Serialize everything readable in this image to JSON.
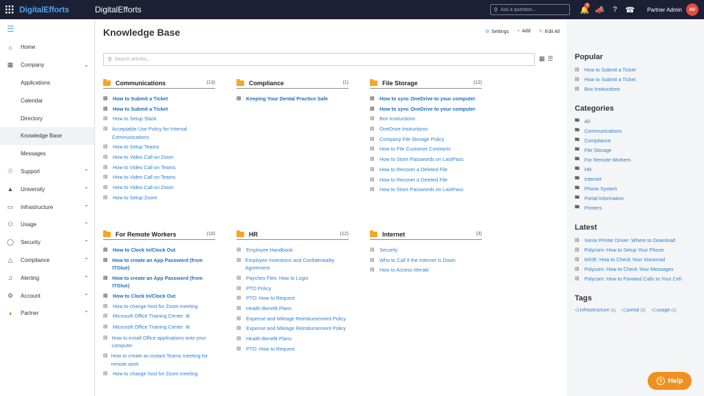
{
  "topbar": {
    "logo": "DigitalEfforts",
    "app_name": "DigitalEfforts",
    "search_placeholder": "Ask a question...",
    "notification_count": "6",
    "user_name": "Partner Admin",
    "avatar_initials": "AV"
  },
  "sidebar": {
    "items": [
      {
        "label": "Home",
        "icon": "home-icon",
        "chevron": false
      },
      {
        "label": "Company",
        "icon": "building-icon",
        "chevron": true
      },
      {
        "label": "Applications",
        "sub": true
      },
      {
        "label": "Calendar",
        "sub": true
      },
      {
        "label": "Directory",
        "sub": true
      },
      {
        "label": "Knowledge Base",
        "sub": true,
        "active": true
      },
      {
        "label": "Messages",
        "sub": true
      },
      {
        "label": "Support",
        "icon": "globe-icon",
        "chevron": true
      },
      {
        "label": "University",
        "icon": "graduation-cap-icon",
        "chevron": true
      },
      {
        "label": "Infrastructure",
        "icon": "monitor-icon",
        "chevron": true
      },
      {
        "label": "Usage",
        "icon": "users-icon",
        "chevron": true
      },
      {
        "label": "Security",
        "icon": "shield-icon",
        "chevron": true
      },
      {
        "label": "Compliance",
        "icon": "warning-icon",
        "chevron": true
      },
      {
        "label": "Alerting",
        "icon": "bell-icon",
        "chevron": true
      },
      {
        "label": "Account",
        "icon": "gear-icon",
        "chevron": true
      },
      {
        "label": "Partner",
        "icon": "partner-icon",
        "chevron": true
      }
    ]
  },
  "main": {
    "title": "Knowledge Base",
    "settings_label": "Settings",
    "add_label": "Add",
    "edit_all_label": "Edit All",
    "search_placeholder": "Search articles..."
  },
  "categories": [
    {
      "name": "Communications",
      "count": "(13)",
      "articles": [
        {
          "t": "How to Submit a Ticket",
          "b": true
        },
        {
          "t": "How to Submit a Ticket",
          "b": true
        },
        {
          "t": "How to Setup Slack"
        },
        {
          "t": "Acceptable Use Policy for Internal Communications"
        },
        {
          "t": "How to Setup Teams"
        },
        {
          "t": "How to Video Call on Zoom"
        },
        {
          "t": "How to Video Call on Teams"
        },
        {
          "t": "How to Video Call on Teams"
        },
        {
          "t": "How to Video Call on Zoom"
        },
        {
          "t": "How to Setup Zoom"
        }
      ]
    },
    {
      "name": "Compliance",
      "count": "(1)",
      "articles": [
        {
          "t": "Keeping Your Dental Practice Safe",
          "b": true
        }
      ]
    },
    {
      "name": "File Storage",
      "count": "(12)",
      "articles": [
        {
          "t": "How to sync OneDrive to your computer",
          "b": true
        },
        {
          "t": "How to sync OneDrive to your computer",
          "b": true
        },
        {
          "t": "Box Instructions"
        },
        {
          "t": "OneDrive Instructions"
        },
        {
          "t": "Company File Storage Policy"
        },
        {
          "t": "How to File Customer Contracts"
        },
        {
          "t": "How to Store Passwords on LastPass"
        },
        {
          "t": "How to Recover a Deleted File"
        },
        {
          "t": "How to Recover a Deleted File"
        },
        {
          "t": "How to Store Passwords on LastPass"
        }
      ]
    },
    {
      "name": "For Remote Workers",
      "count": "(10)",
      "articles": [
        {
          "t": "How to Clock In/Clock Out",
          "b": true
        },
        {
          "t": "How to create an App Password (from ITGlue)",
          "b": true
        },
        {
          "t": "How to create an App Password (from ITGlue)",
          "b": true
        },
        {
          "t": "How to Clock In/Clock Out",
          "b": true
        },
        {
          "t": "How to change host for Zoom meeting"
        },
        {
          "t": "Microsoft Office Training Center",
          "ext": true
        },
        {
          "t": "Microsoft Office Training Center",
          "ext": true
        },
        {
          "t": "How to install Office applications onto your computer"
        },
        {
          "t": "How to create an instant Teams meeting for remote work"
        },
        {
          "t": "How to change host for Zoom meeting"
        }
      ]
    },
    {
      "name": "HR",
      "count": "(12)",
      "articles": [
        {
          "t": "Employee Handbook"
        },
        {
          "t": "Employee Inventions and Confidentiality Agreement"
        },
        {
          "t": "Paychex Flex: How to Login"
        },
        {
          "t": "PTO Policy"
        },
        {
          "t": "PTO: How to Request"
        },
        {
          "t": "Health Benefit Plans"
        },
        {
          "t": "Expense and Mileage Reimbursement Policy"
        },
        {
          "t": "Expense and Mileage Reimbursement Policy"
        },
        {
          "t": "Health Benefit Plans"
        },
        {
          "t": "PTO: How to Request"
        }
      ]
    },
    {
      "name": "Internet",
      "count": "(3)",
      "articles": [
        {
          "t": "Security"
        },
        {
          "t": "Who to Call If the Internet is Down"
        },
        {
          "t": "How to Access Meraki"
        }
      ]
    }
  ],
  "right": {
    "popular_title": "Popular",
    "popular": [
      "How to Submit a Ticket",
      "How to Submit a Ticket",
      "Box Instructions"
    ],
    "categories_title": "Categories",
    "categories": [
      "All",
      "Communications",
      "Compliance",
      "File Storage",
      "For Remote Workers",
      "HR",
      "Internet",
      "Phone System",
      "Portal Information",
      "Printers"
    ],
    "latest_title": "Latest",
    "latest": [
      "Xerox Printer Driver: Where to Download",
      "Polycom: How to Setup Your Phone",
      "MXIE: How to Check Your Voicemail",
      "Polycom: How to Check Your Messages",
      "Polycom: How to Forward Calls to Your Cell"
    ],
    "tags_title": "Tags",
    "tags": [
      {
        "name": "infrastructure",
        "count": "(1)"
      },
      {
        "name": "portal",
        "count": "(2)"
      },
      {
        "name": "usage",
        "count": "(1)"
      }
    ]
  },
  "help_label": "Help",
  "colors": {
    "topbar": "#1c2035",
    "accent": "#4aa3e8",
    "link": "#2b7fd0",
    "folder": "#f6a623",
    "help": "#f0901e",
    "avatar": "#e14a3c"
  }
}
